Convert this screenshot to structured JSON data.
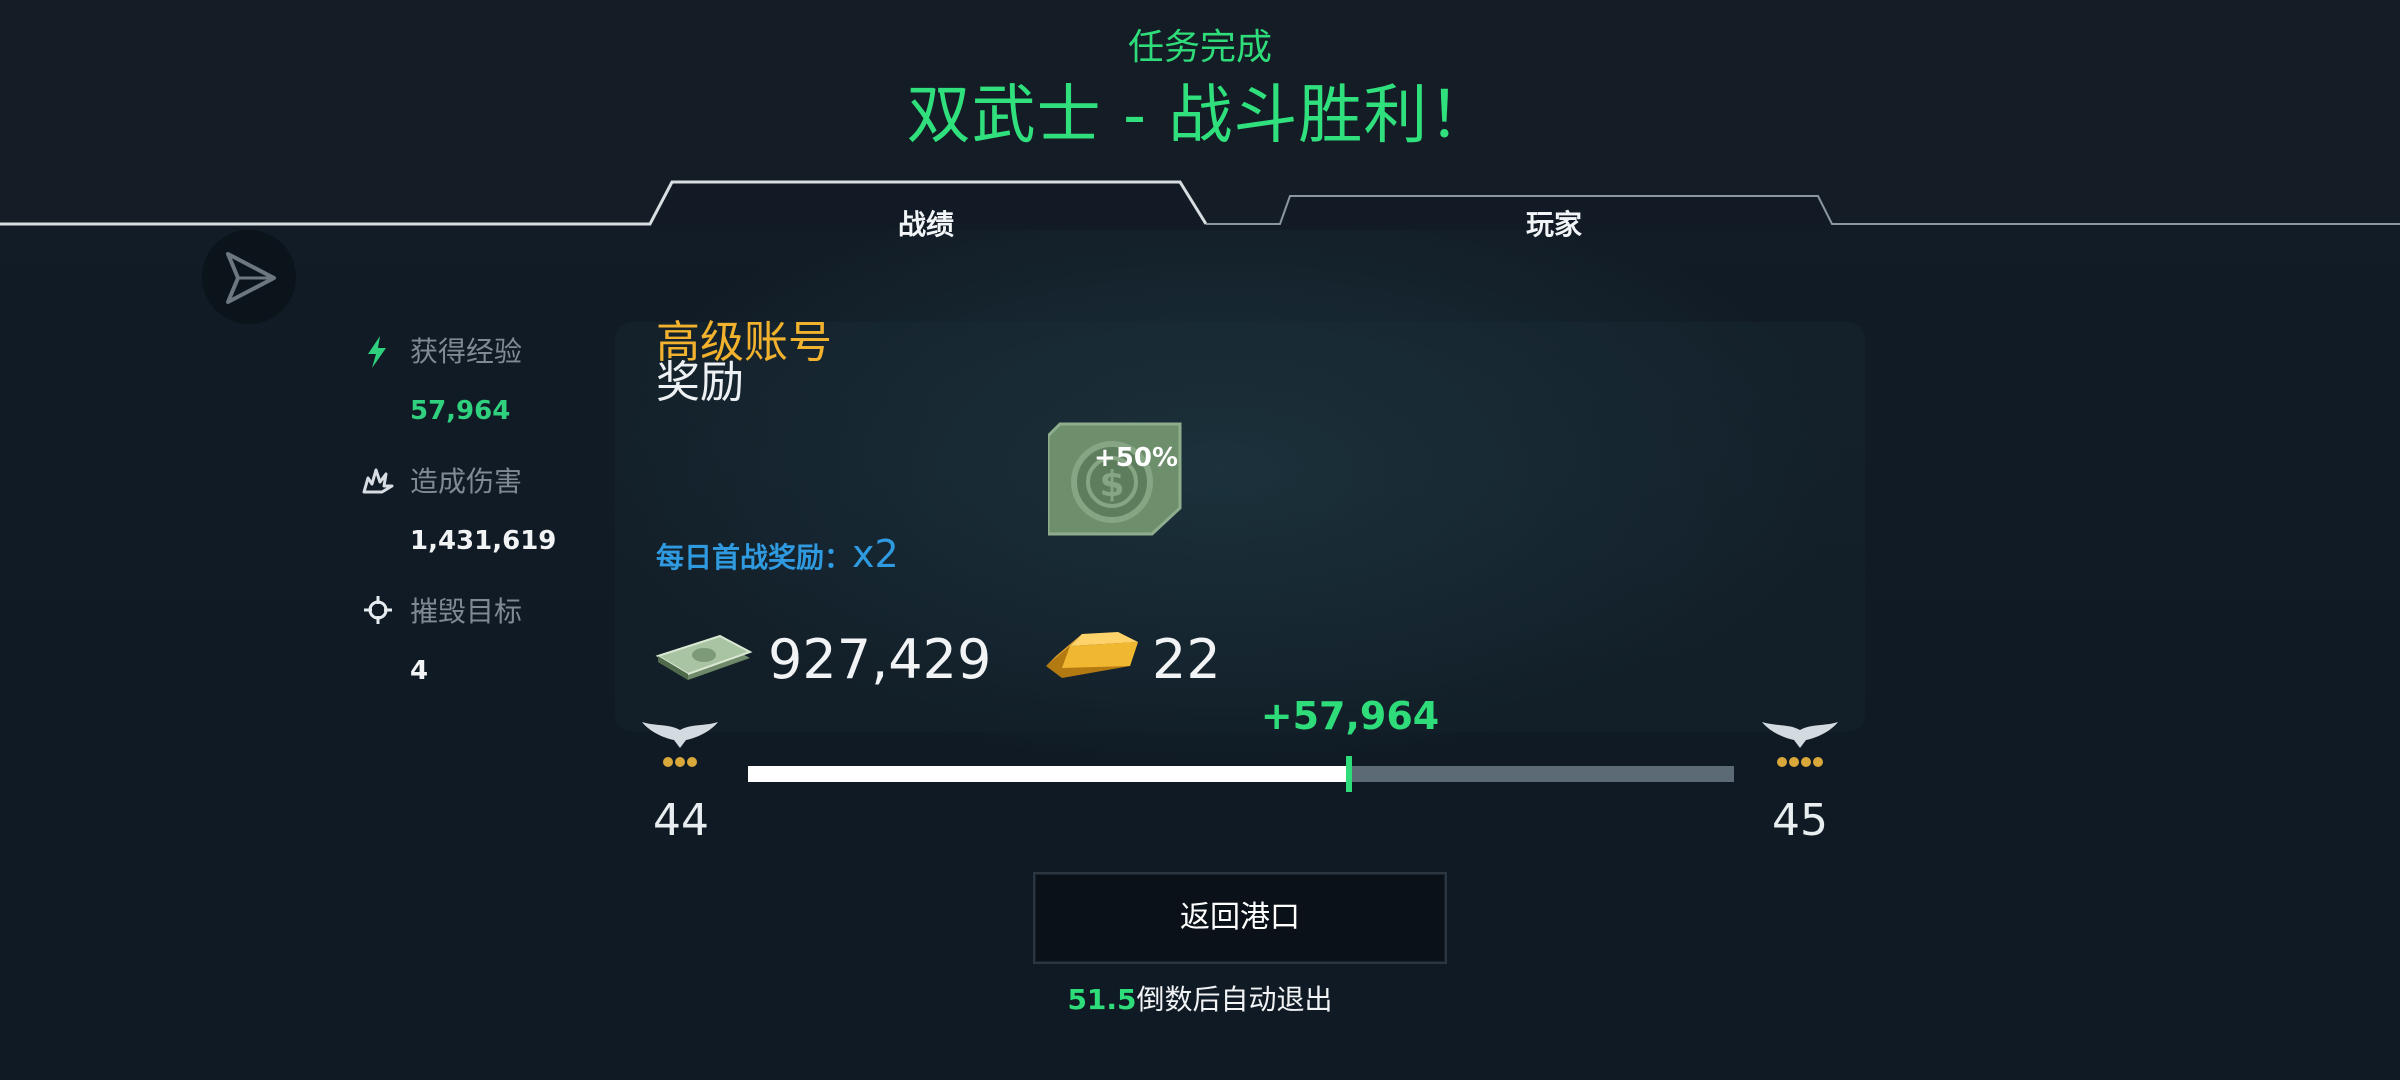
{
  "header": {
    "subtitle": "任务完成",
    "title": "双武士 - 战斗胜利！"
  },
  "tabs": [
    {
      "label": "战绩",
      "active": true
    },
    {
      "label": "玩家",
      "active": false
    }
  ],
  "share": {
    "icon": "send-icon"
  },
  "stats": [
    {
      "icon": "lightning-icon",
      "label": "获得经验",
      "value": "57,964",
      "value_color": "#2fd07e"
    },
    {
      "icon": "explosion-icon",
      "label": "造成伤害",
      "value": "1,431,619",
      "value_color": "#f1f3f5"
    },
    {
      "icon": "crosshair-icon",
      "label": "摧毁目标",
      "value": "4",
      "value_color": "#f1f3f5"
    }
  ],
  "rewards": {
    "premium_label": "高级账号",
    "reward_label": "奖励",
    "bonus_badge": "+50%",
    "daily_bonus_label": "每日首战奖励：",
    "daily_bonus_multiplier": "x2",
    "credits": "927,429",
    "gold": "22"
  },
  "progress": {
    "xp_gain": "+57,964",
    "current_level": "44",
    "next_level": "45",
    "fill_fraction": 0.61
  },
  "return_button": {
    "label": "返回港口"
  },
  "countdown": {
    "seconds": "51.5",
    "text": "倒数后自动退出"
  },
  "colors": {
    "accent_green": "#2fdc7a",
    "premium_gold": "#f2b22d",
    "bonus_blue": "#2f9ae0",
    "background": "#101a24"
  }
}
